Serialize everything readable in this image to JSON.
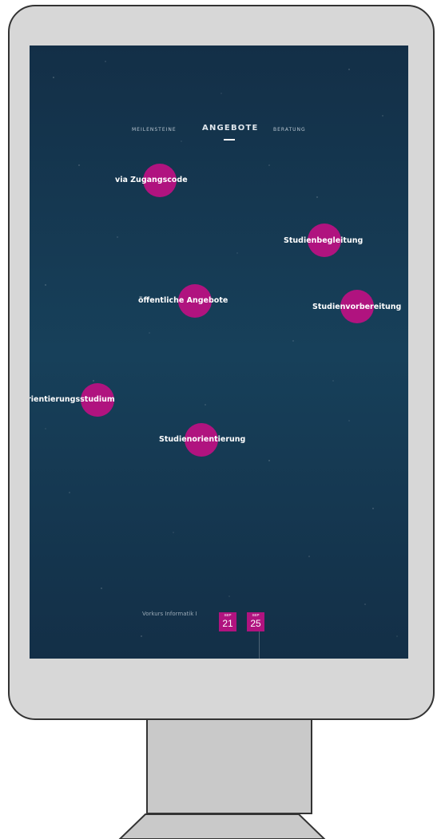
{
  "nav": {
    "items": [
      "Meilensteine",
      "Angebote",
      "Beratung"
    ],
    "active": "Angebote"
  },
  "bubbles": [
    {
      "label": "via Zugangscode"
    },
    {
      "label": "Studienbegleitung"
    },
    {
      "label": "öffentliche Angebote"
    },
    {
      "label": "Studienvorbereitung"
    },
    {
      "label": "Orientierungsstudium"
    },
    {
      "label": "Studienorientierung"
    }
  ],
  "timeline": {
    "course": "Vorkurs Informatik I",
    "dates": [
      {
        "month": "SEP",
        "day": "21"
      },
      {
        "month": "SEP",
        "day": "25"
      }
    ]
  },
  "tabbar": {
    "icons": [
      "bell-icon",
      "chat-icon",
      "search-icon",
      "user-icon"
    ],
    "notification_color": "#e0167f"
  },
  "colors": {
    "accent": "#b0137f",
    "background": "#15364f"
  }
}
